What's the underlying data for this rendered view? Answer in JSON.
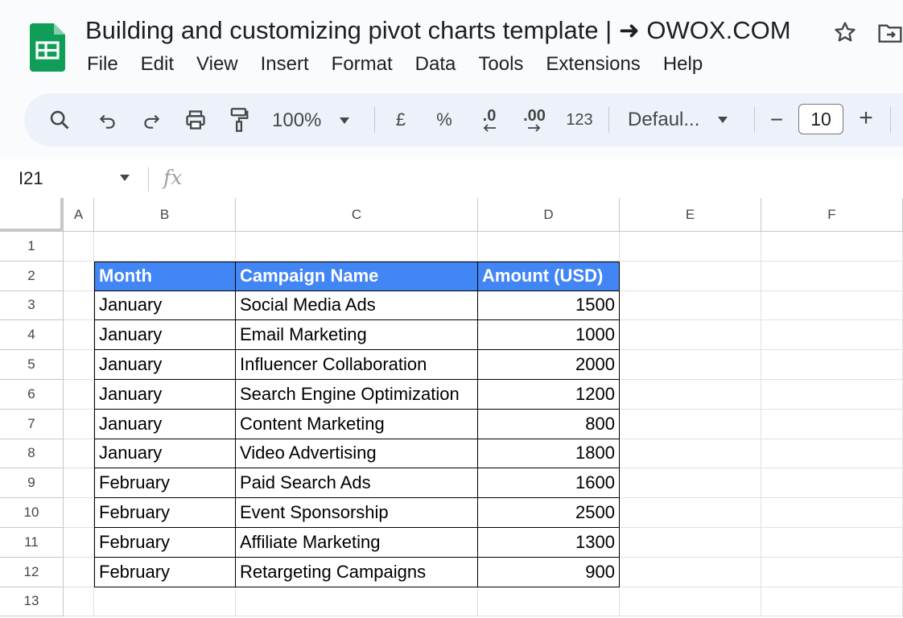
{
  "window": {
    "doc_title": "Building and customizing pivot charts template | ➜ OWOX.COM"
  },
  "menu": [
    "File",
    "Edit",
    "View",
    "Insert",
    "Format",
    "Data",
    "Tools",
    "Extensions",
    "Help"
  ],
  "toolbar": {
    "zoom": "100%",
    "currency": "£",
    "percent": "%",
    "decrease_decimal": ".0",
    "increase_decimal": ".00",
    "number_format": "123",
    "font": "Defaul...",
    "font_size": "10",
    "minus": "−",
    "plus": "+"
  },
  "formula_bar": {
    "name_box": "I21",
    "fx": "fx",
    "value": ""
  },
  "grid": {
    "columns": [
      "A",
      "B",
      "C",
      "D",
      "E",
      "F"
    ],
    "rows": [
      "1",
      "2",
      "3",
      "4",
      "5",
      "6",
      "7",
      "8",
      "9",
      "10",
      "11",
      "12",
      "13"
    ],
    "table_headers": [
      "Month",
      "Campaign Name",
      "Amount (USD)"
    ],
    "table_rows": [
      [
        "January",
        "Social Media Ads",
        "1500"
      ],
      [
        "January",
        "Email Marketing",
        "1000"
      ],
      [
        "January",
        "Influencer Collaboration",
        "2000"
      ],
      [
        "January",
        "Search Engine Optimization",
        "1200"
      ],
      [
        "January",
        "Content Marketing",
        "800"
      ],
      [
        "January",
        "Video Advertising",
        "1800"
      ],
      [
        "February",
        "Paid Search Ads",
        "1600"
      ],
      [
        "February",
        "Event Sponsorship",
        "2500"
      ],
      [
        "February",
        "Affiliate Marketing",
        "1300"
      ],
      [
        "February",
        "Retargeting Campaigns",
        "900"
      ]
    ]
  },
  "colors": {
    "header_fill": "#4285f4",
    "toolbar_bg": "#edf2fa",
    "logo_green": "#0f9d58"
  }
}
